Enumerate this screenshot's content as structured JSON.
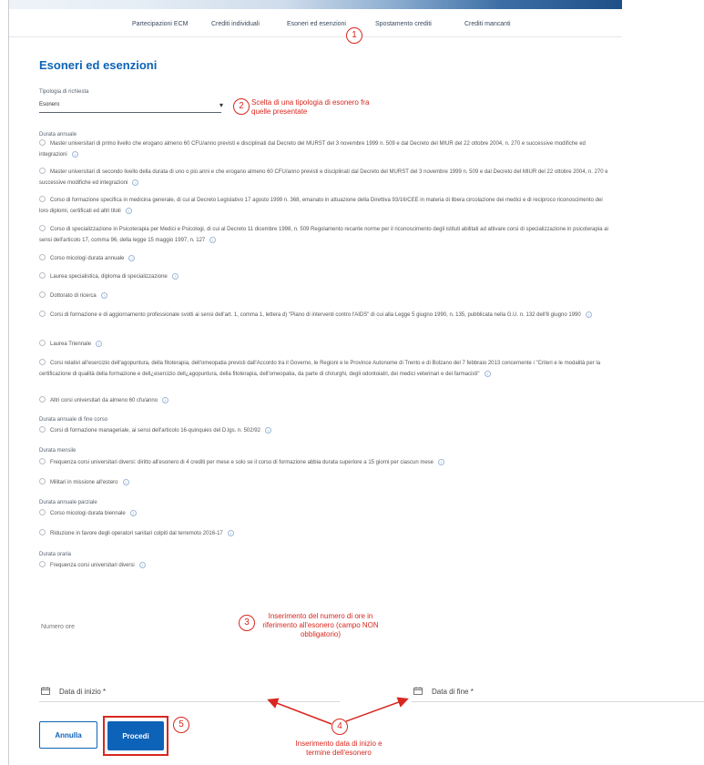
{
  "nav": {
    "tabs": [
      {
        "label": "Partecipazioni ECM"
      },
      {
        "label": "Crediti individuali"
      },
      {
        "label": "Esoneri ed esenzioni"
      },
      {
        "label": "Spostamento crediti"
      },
      {
        "label": "Crediti mancanti"
      }
    ]
  },
  "page": {
    "title": "Esoneri ed esenzioni"
  },
  "request_type": {
    "label": "Tipologia di richiesta",
    "value": "Esonero"
  },
  "groups": [
    {
      "title": "Durata annuale",
      "options": [
        "Master universitari di primo livello che erogano almeno 60 CFU/anno previsti e disciplinati dal Decreto del MURST del 3 novembre 1999 n. 509 e dal Decreto del MIUR del 22 ottobre 2004, n. 270 e successive modifiche ed integrazioni",
        "Master universitari di secondo livello della durata di uno o più anni e che erogano almeno 60 CFU/anno previsti e disciplinati dal Decreto del MURST del 3 novembre 1999 n. 509 e dal Decreto del MIUR del 22 ottobre 2004, n. 270 e successive modifiche ed integrazioni",
        "Corso di formazione specifica in medicina generale, di cui al Decreto Legislativo 17 agosto 1999 n. 368, emanato in attuazione della Direttiva 93/16/CEE in materia di libera circolazione dei medici e di reciproco riconoscimento dei loro diplomi, certificati ed altri titoli",
        "Corso di specializzazione in Psicoterapia per Medici e Psicologi, di cui al Decreto 11 dicembre 1998, n. 509 Regolamento recante norme per il riconoscimento degli istituti abilitati ad attivare corsi di specializzazione in psicoterapia ai sensi dell'articolo 17, comma 96, della legge 15 maggio 1997, n. 127",
        "Corso micologi durata annuale",
        "Laurea specialistica, diploma di specializzazione",
        "Dottorato di ricerca",
        "Corsi di formazione e di aggiornamento professionale svolti ai sensi dell'art. 1, comma 1, lettera d) \"Piano di interventi contro l'AIDS\" di cui alla Legge 5 giugno 1990, n. 135, pubblicata nella G.U. n. 132 dell'8 giugno 1990",
        "Laurea Triennale",
        "Corsi relativi all'esercizio dell'agopuntura, della fitoterapia, dell'omeopatia previsti dall'Accordo tra il Governo, le Regioni e le Province Autonome di Trento e di Bolzano del 7 febbraio 2013 concernente i \"Criteri e le modalità per la certificazione di qualità della formazione e dell¿esercizio dell¿agopuntura, della fitoterapia, dell'omeopatia, da parte di chirurghi, degli odontoiatri, dei medici veterinari e dei farmacisti\"",
        "Altri corsi universitari da almeno 60 cfu/anno"
      ]
    },
    {
      "title": "Durata annuale di fine corso",
      "options": [
        "Corsi di formazione manageriale, ai sensi dell'articolo 16-quinquies del D.lgs. n. 502/92"
      ]
    },
    {
      "title": "Durata mensile",
      "options": [
        "Frequenza corsi universitari diversi: diritto all'esonero di 4 crediti per mese e solo se il corso di formazione abbia durata superiore a 15 giorni per ciascun mese",
        "Militari in missione all'estero"
      ]
    },
    {
      "title": "Durata annuale parziale",
      "options": [
        "Corso micologi durata biennale",
        "Riduzione in favore degli operatori sanitari colpiti dal terremoto 2016-17"
      ]
    },
    {
      "title": "Durata oraria",
      "options": [
        "Frequenza corsi universitari diversi"
      ]
    }
  ],
  "hours": {
    "placeholder": "Numero ore"
  },
  "dates": {
    "start_label": "Data di inizio *",
    "end_label": "Data di fine *"
  },
  "actions": {
    "cancel": "Annulla",
    "proceed": "Procedi"
  },
  "info_glyph": "i",
  "annotations": [
    {
      "number": "1",
      "text": ""
    },
    {
      "number": "2",
      "text": "Scelta di una tipologia di esonero fra quelle presentate"
    },
    {
      "number": "3",
      "text": "Inserimento del numero di ore in riferimento all'esonero (campo NON obbligatorio)"
    },
    {
      "number": "4",
      "text": "Inserimento data di inizio e termine dell'esonero"
    },
    {
      "number": "5",
      "text": ""
    }
  ],
  "colors": {
    "primary": "#0d63b7",
    "annotation": "#d8271f"
  }
}
